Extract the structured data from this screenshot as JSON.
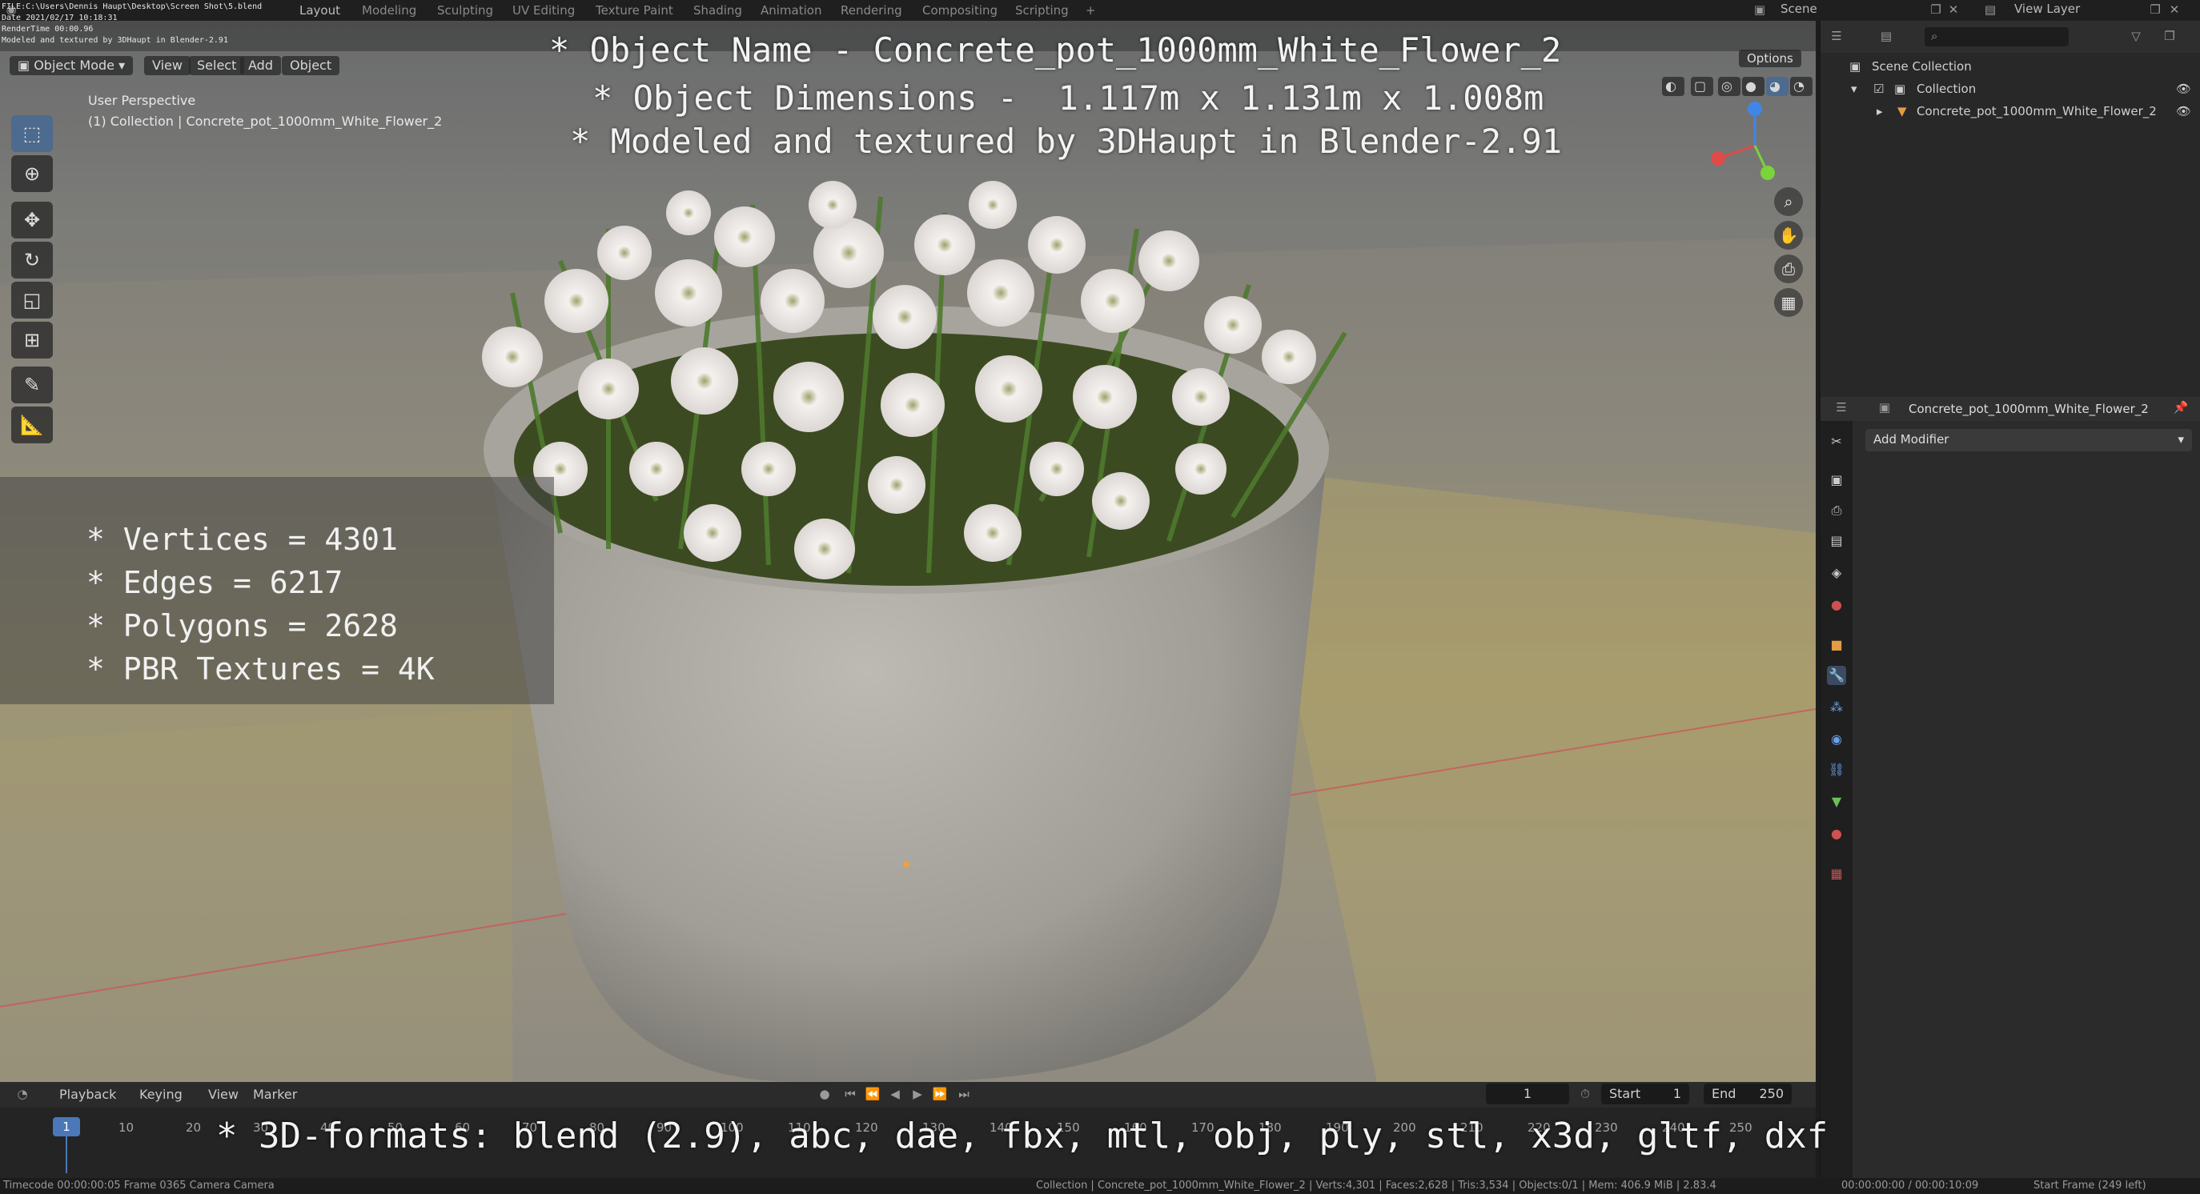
{
  "file_info": {
    "file": "FILE:C:\\Users\\Dennis Haupt\\Desktop\\Screen Shot\\5.blend",
    "date": "Date 2021/02/17 10:18:31",
    "render_time": "RenderTime 00:00.96",
    "credit": "Modeled and textured by 3DHaupt in Blender-2.91"
  },
  "top_tabs": [
    "Layout",
    "Modeling",
    "Sculpting",
    "UV Editing",
    "Texture Paint",
    "Shading",
    "Animation",
    "Rendering",
    "Compositing",
    "Scripting",
    "+"
  ],
  "active_tab": "Layout",
  "scene_name": "Scene",
  "view_layer": "View Layer",
  "viewport": {
    "mode": "Object Mode",
    "menus": [
      "View",
      "Select",
      "Add",
      "Object"
    ],
    "perspective": "User Perspective",
    "collection_line": "(1) Collection | Concrete_pot_1000mm_White_Flower_2",
    "options_label": "Options"
  },
  "overlay": {
    "title": "* Object Name - Concrete_pot_1000mm_White_Flower_2",
    "dimensions": "* Object Dimensions -  1.117m x 1.131m x 1.008m",
    "credit": "* Modeled and textured by 3DHaupt in Blender-2.91",
    "stats": [
      "* Vertices = 4301",
      "* Edges = 6217",
      "* Polygons = 2628",
      "* PBR Textures = 4K"
    ],
    "formats": "* 3D-formats: blend (2.9), abc, dae, fbx, mtl, obj, ply, stl, x3d, gltf, dxf"
  },
  "tools": [
    "select-box",
    "cursor",
    "move",
    "rotate",
    "scale",
    "transform",
    "annotate",
    "measure"
  ],
  "outliner": {
    "root": "Scene Collection",
    "collection": "Collection",
    "object": "Concrete_pot_1000mm_White_Flower_2"
  },
  "properties": {
    "object_name": "Concrete_pot_1000mm_White_Flower_2",
    "add_modifier": "Add Modifier"
  },
  "timeline": {
    "menus": [
      "Playback",
      "Keying",
      "View",
      "Marker"
    ],
    "current_frame": "1",
    "start_label": "Start",
    "start": "1",
    "end_label": "End",
    "end": "250",
    "ticks": [
      "1",
      "10",
      "20",
      "30",
      "40",
      "50",
      "60",
      "70",
      "80",
      "90",
      "100",
      "110",
      "120",
      "130",
      "140",
      "150",
      "160",
      "170",
      "180",
      "190",
      "200",
      "210",
      "220",
      "230",
      "240",
      "250"
    ]
  },
  "status": {
    "left": "Timecode 00:00:00:05   Frame 0365   Camera Camera",
    "center": "Collection | Concrete_pot_1000mm_White_Flower_2 | Verts:4,301 | Faces:2,628 | Tris:3,534 | Objects:0/1 | Mem: 406.9 MiB | 2.83.4",
    "time": "00:00:00:00 / 00:00:10:09",
    "right": "Start Frame (249 left)"
  },
  "colors": {
    "axis_x": "#e04a4a",
    "axis_y": "#7bd23a",
    "axis_z": "#3f86e8",
    "accent": "#4a78b8"
  }
}
